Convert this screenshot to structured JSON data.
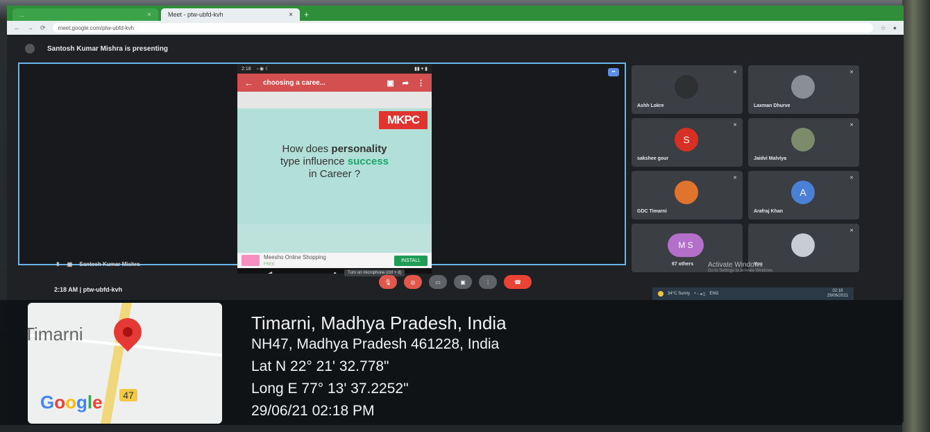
{
  "browser": {
    "tabs": [
      {
        "label": "..."
      },
      {
        "label": "Meet - ptw-ubfd-kvh"
      }
    ],
    "address": "meet.google.com/ptw-ubfd-kvh"
  },
  "meet": {
    "presenting_banner": "Santosh Kumar Mishra is presenting",
    "presenter_label": "Santosh Kumar Mishra",
    "time_code": "2:18 AM | ptw-ubfd-kvh",
    "tooltip": "Turn on microphone (ctrl + d)",
    "participants": [
      {
        "name": "Ashh Lokre"
      },
      {
        "name": "Laxman Dhurve"
      },
      {
        "name": "sakshee gour",
        "initial": "S",
        "color": "#d93025"
      },
      {
        "name": "Jaidvi Malviya"
      },
      {
        "name": "GDC Timarni"
      },
      {
        "name": "Arafraj Khan",
        "initial": "A",
        "color": "#4a80d6"
      },
      {
        "name": "67 others",
        "initial": "M S"
      },
      {
        "name": "You"
      }
    ]
  },
  "phone": {
    "status_time": "2:18",
    "app_title": "choosing a caree...",
    "slide": {
      "brand": "MKPC",
      "line1_plain": "How does ",
      "line1_bold": "personality",
      "line2_plain": "type influence ",
      "line2_highlight": "success",
      "line3": "in Career ?"
    },
    "ad": {
      "title": "Meesho Online Shopping",
      "sub": "FREE",
      "button": "INSTALL"
    }
  },
  "windows": {
    "activate_title": "Activate Windows",
    "activate_sub": "Go to Settings to activate Windows.",
    "weather": "34°C Sunny",
    "lang": "ENG",
    "clock_time": "02:18",
    "clock_date": "29/06/2021"
  },
  "geotag": {
    "place": "Timarni",
    "city": "Timarni, Madhya Pradesh, India",
    "address": "NH47, Madhya Pradesh 461228, India",
    "lat": "Lat N 22° 21' 32.778\"",
    "long": "Long E 77° 13' 37.2252\"",
    "datetime": "29/06/21 02:18 PM",
    "road_shield": "47",
    "map_brand": "Google"
  }
}
